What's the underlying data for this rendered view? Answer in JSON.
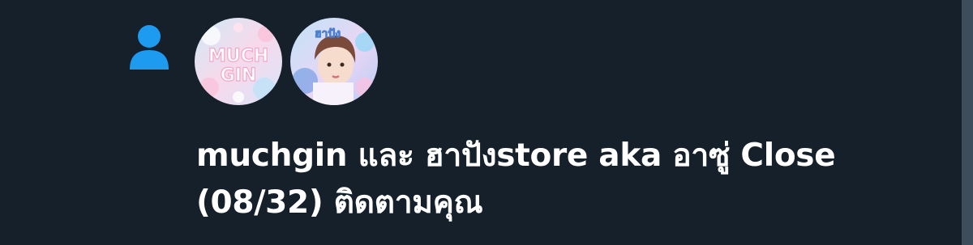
{
  "colors": {
    "background": "#15202b",
    "accent": "#1d9bf0",
    "text": "#ffffff"
  },
  "icon": {
    "name": "person-icon"
  },
  "avatars": [
    {
      "name": "muchgin-avatar",
      "logo_text_line1": "MUCH",
      "logo_text_line2": "GIN"
    },
    {
      "name": "hapang-store-avatar",
      "logo_text": "ฮาปัง"
    }
  ],
  "notification": {
    "user1": "muchgin",
    "conjunction": " และ ",
    "user2": "ฮาปังstore aka อาซู่ Close (08/32)",
    "action": " ติดตามคุณ"
  }
}
